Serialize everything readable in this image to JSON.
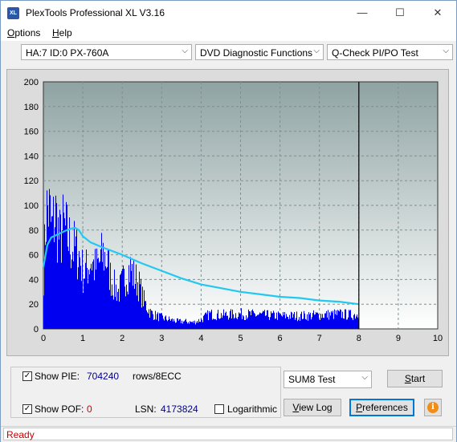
{
  "window": {
    "title": "PlexTools Professional XL V3.16",
    "icon_text": "XL",
    "controls": {
      "minimize": "—",
      "maximize": "☐",
      "close": "✕"
    }
  },
  "menu": {
    "items": [
      {
        "label": "Options",
        "mnemonic": "O"
      },
      {
        "label": "Help",
        "mnemonic": "H"
      }
    ]
  },
  "toolbar": {
    "drive": "HA:7 ID:0  PX-760A",
    "function": "DVD Diagnostic Functions",
    "test": "Q-Check PI/PO Test"
  },
  "chart_data": {
    "type": "area",
    "xlim": [
      0,
      10
    ],
    "ylim": [
      0,
      200
    ],
    "x_ticks": [
      0,
      1,
      2,
      3,
      4,
      5,
      6,
      7,
      8,
      9,
      10
    ],
    "y_ticks": [
      0,
      20,
      40,
      60,
      80,
      100,
      120,
      140,
      160,
      180,
      200
    ],
    "grid": true,
    "test_end_x": 8.0,
    "colors": {
      "bars": "#0000f0",
      "curve": "#22c8f0",
      "plot_top": "#8fa3a3",
      "plot_bottom": "#ffffff",
      "grid": "#7f8f8f"
    },
    "series": [
      {
        "kind": "pie_envelope",
        "x": [
          0.0,
          0.05,
          0.1,
          0.15,
          0.2,
          0.3,
          0.4,
          0.5,
          0.6,
          0.7,
          0.8,
          0.9,
          1.0,
          1.1,
          1.2,
          1.3,
          1.4,
          1.5,
          1.6,
          1.7,
          1.8,
          1.9,
          2.0,
          2.1,
          2.2,
          2.3,
          2.4,
          2.5,
          2.6,
          2.7,
          2.8,
          3.0,
          3.2,
          3.4,
          3.6,
          3.8,
          4.0,
          4.2,
          4.5,
          5.0,
          5.5,
          6.0,
          6.5,
          7.0,
          7.5,
          7.8,
          8.0
        ],
        "y": [
          60,
          120,
          130,
          125,
          105,
          125,
          95,
          110,
          100,
          90,
          85,
          80,
          60,
          65,
          75,
          65,
          70,
          80,
          75,
          55,
          45,
          40,
          50,
          60,
          65,
          55,
          50,
          35,
          25,
          18,
          15,
          12,
          10,
          8,
          8,
          7,
          10,
          16,
          15,
          16,
          15,
          14,
          14,
          15,
          16,
          15,
          16
        ]
      },
      {
        "kind": "avg_curve",
        "x": [
          0.0,
          0.1,
          0.2,
          0.4,
          0.6,
          0.8,
          0.9,
          1.0,
          1.2,
          1.5,
          2.0,
          2.5,
          3.0,
          3.5,
          4.0,
          4.5,
          5.0,
          5.5,
          6.0,
          6.5,
          7.0,
          7.5,
          8.0
        ],
        "y": [
          50,
          68,
          74,
          77,
          80,
          82,
          80,
          75,
          70,
          66,
          60,
          53,
          47,
          41,
          36,
          33,
          30,
          28,
          26,
          25,
          23,
          22,
          20
        ]
      }
    ]
  },
  "panel": {
    "show_pie": {
      "label": "Show PIE:",
      "checked": true,
      "value": "704240",
      "unit": "rows/8ECC"
    },
    "show_pof": {
      "label": "Show POF:",
      "checked": true,
      "value": "0"
    },
    "lsn": {
      "label": "LSN:",
      "value": "4173824"
    },
    "logarithmic": {
      "label": "Logarithmic",
      "checked": false
    },
    "test_select": "SUM8 Test",
    "buttons": {
      "start": "Start",
      "view_log": "View Log",
      "preferences": "Preferences"
    }
  },
  "status": {
    "text": "Ready"
  }
}
